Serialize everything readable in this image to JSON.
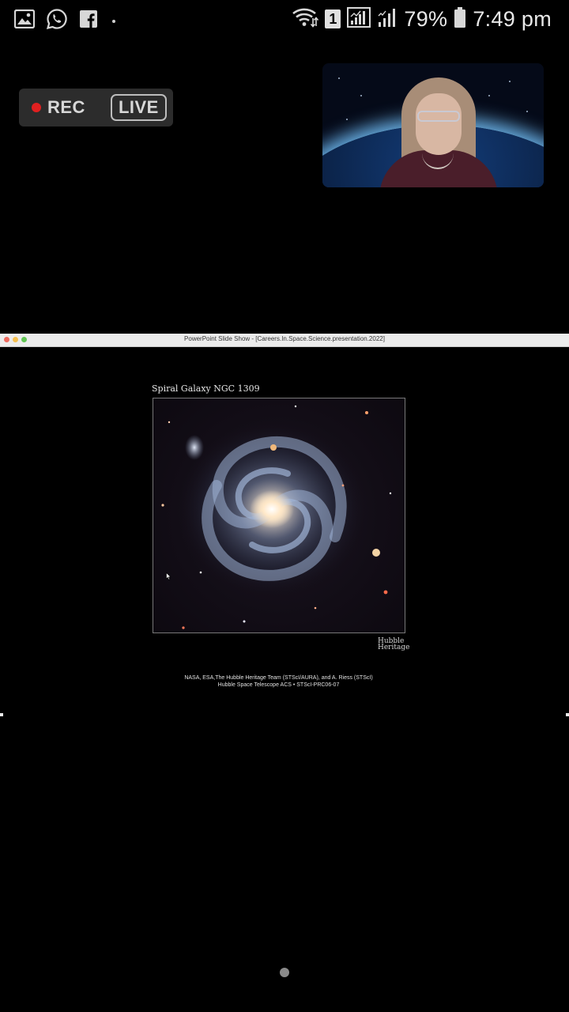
{
  "status_bar": {
    "battery_percent": "79%",
    "time": "7:49 pm",
    "sim_slot": "1",
    "notification_icons": [
      "gallery-icon",
      "whatsapp-icon",
      "facebook-icon"
    ]
  },
  "recording": {
    "rec_label": "REC",
    "live_label": "LIVE",
    "rec_color": "#e02020"
  },
  "presentation": {
    "window_title": "PowerPoint Slide Show - [Careers.In.Space.Science.presentation.2022]",
    "slide_title": "Spiral Galaxy NGC 1309",
    "logo_line1": "Hubble",
    "logo_line2": "Heritage",
    "credit_line1": "NASA, ESA,The Hubble Heritage Team (STScI/AURA), and A. Riess (STScI)",
    "credit_line2": "Hubble Space Telescope ACS • STScI-PRC06-07"
  },
  "pager": {
    "pages": 1,
    "current": 1
  }
}
